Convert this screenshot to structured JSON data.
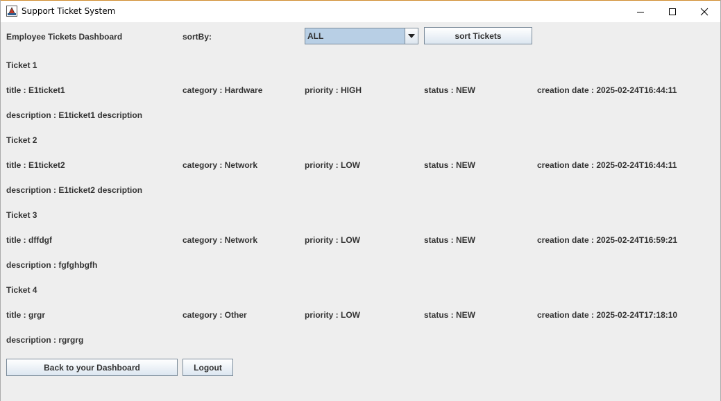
{
  "window": {
    "title": "Support Ticket System"
  },
  "header": {
    "dashboard_label": "Employee Tickets Dashboard",
    "sort_label": "sortBy:",
    "sort_selected": "ALL",
    "sort_button": "sort Tickets"
  },
  "tickets": [
    {
      "heading": "Ticket 1",
      "title": "title : E1ticket1",
      "category": "category : Hardware",
      "priority": "priority : HIGH",
      "status": "status : NEW",
      "created": "creation date : 2025-02-24T16:44:11",
      "description": "description : E1ticket1 description"
    },
    {
      "heading": "Ticket 2",
      "title": "title : E1ticket2",
      "category": "category : Network",
      "priority": "priority : LOW",
      "status": "status : NEW",
      "created": "creation date : 2025-02-24T16:44:11",
      "description": "description : E1ticket2 description"
    },
    {
      "heading": "Ticket 3",
      "title": "title : dffdgf",
      "category": "category : Network",
      "priority": "priority : LOW",
      "status": "status : NEW",
      "created": "creation date : 2025-02-24T16:59:21",
      "description": "description : fgfghbgfh"
    },
    {
      "heading": "Ticket 4",
      "title": "title : grgr",
      "category": "category : Other",
      "priority": "priority : LOW",
      "status": "status : NEW",
      "created": "creation date : 2025-02-24T17:18:10",
      "description": "description : rgrgrg"
    }
  ],
  "footer": {
    "back_button": "Back to your Dashboard",
    "logout_button": "Logout"
  },
  "icons": {
    "app": "app-icon",
    "minimize": "minimize-icon",
    "maximize": "maximize-icon",
    "close": "close-icon",
    "dropdown": "triangle-down-icon"
  },
  "colors": {
    "background": "#eeeeee",
    "text": "#333333",
    "combo_fill": "#b8cfe5",
    "button_border": "#7a8a99"
  }
}
